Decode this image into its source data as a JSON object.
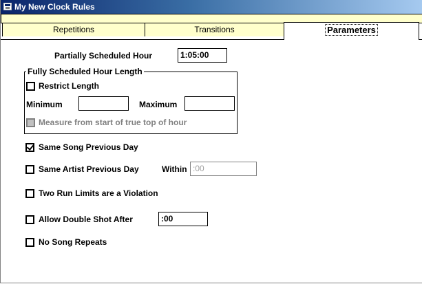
{
  "window": {
    "title": "My New Clock Rules",
    "icon": "app-window-icon"
  },
  "tabs": [
    {
      "label": "Repetitions",
      "active": false
    },
    {
      "label": "Transitions",
      "active": false
    },
    {
      "label": "Parameters",
      "active": true
    }
  ],
  "partial_hour": {
    "label": "Partially Scheduled Hour",
    "value": "1:05:00"
  },
  "full_hour": {
    "legend": "Fully Scheduled Hour Length",
    "restrict": {
      "label": "Restrict Length",
      "checked": false
    },
    "minimum_label": "Minimum",
    "minimum_value": "",
    "maximum_label": "Maximum",
    "maximum_value": "",
    "measure": {
      "label": "Measure from start of true top of hour",
      "checked": false,
      "enabled": false
    }
  },
  "options": {
    "same_song": {
      "label": "Same Song Previous Day",
      "checked": true
    },
    "same_artist": {
      "label": "Same Artist Previous Day",
      "checked": false,
      "within_label": "Within",
      "within_value": ":00"
    },
    "two_run": {
      "label": "Two Run Limits are a Violation",
      "checked": false
    },
    "double_shot": {
      "label": "Allow Double Shot After",
      "checked": false,
      "value": ":00"
    },
    "no_repeats": {
      "label": "No Song Repeats",
      "checked": false
    }
  }
}
